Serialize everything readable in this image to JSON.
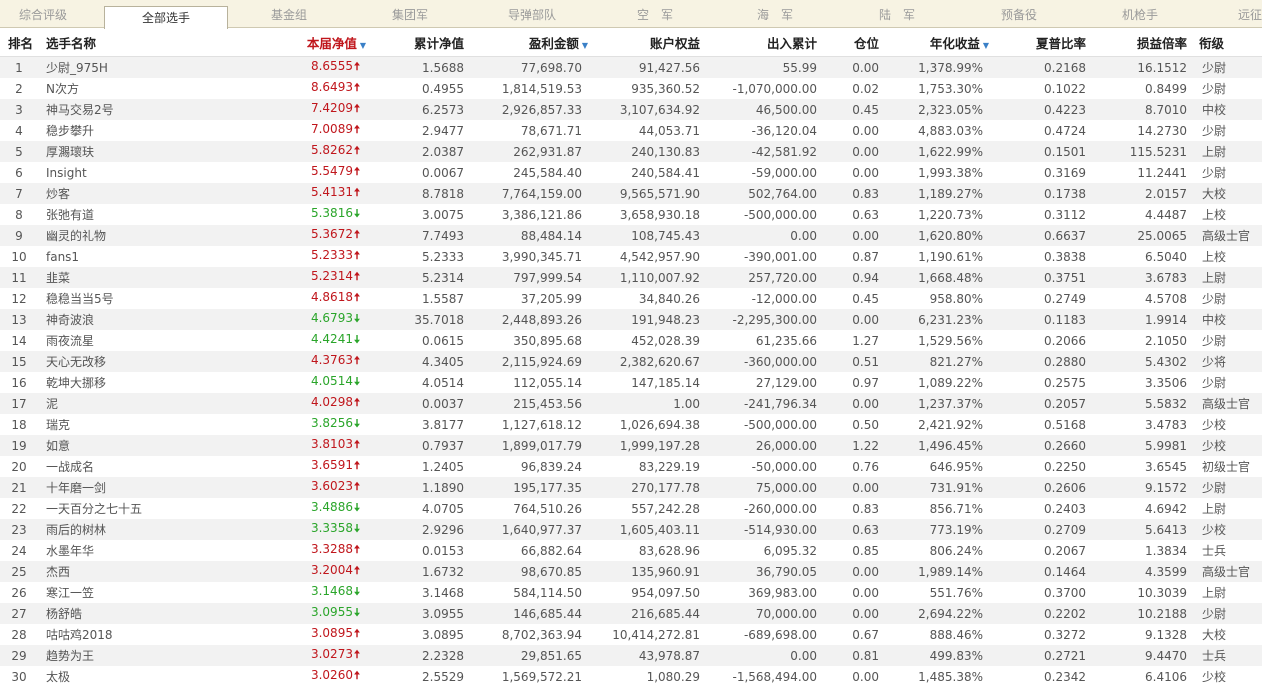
{
  "tabs": [
    {
      "label": "综合评级",
      "active": false
    },
    {
      "label": "全部选手",
      "active": true
    },
    {
      "label": "基金组",
      "active": false
    },
    {
      "label": "集团军",
      "active": false
    },
    {
      "label": "导弹部队",
      "active": false
    },
    {
      "label": "空　军",
      "active": false
    },
    {
      "label": "海　军",
      "active": false
    },
    {
      "label": "陆　军",
      "active": false
    },
    {
      "label": "预备役",
      "active": false
    },
    {
      "label": "机枪手",
      "active": false
    },
    {
      "label": "远征",
      "active": false
    }
  ],
  "columns": {
    "rank": "排名",
    "name": "选手名称",
    "nav": "本届净值",
    "cum": "累计净值",
    "profit": "盈利金额",
    "equity": "账户权益",
    "flow": "出入累计",
    "pos": "仓位",
    "annual": "年化收益",
    "sharpe": "夏普比率",
    "pl": "损益倍率",
    "level": "衔级"
  },
  "sort_indicator": "▼",
  "colors": {
    "up": "#c0161c",
    "down": "#2aa52a",
    "sort": "#3a80c7"
  },
  "rows": [
    {
      "rank": "1",
      "name": "少尉_975H",
      "nav": "8.6555",
      "dir": "up",
      "cum": "1.5688",
      "profit": "77,698.70",
      "equity": "91,427.56",
      "flow": "55.99",
      "pos": "0.00",
      "annual": "1,378.99%",
      "sharpe": "0.2168",
      "pl": "16.1512",
      "level": "少尉"
    },
    {
      "rank": "2",
      "name": "N次方",
      "nav": "8.6493",
      "dir": "up",
      "cum": "0.4955",
      "profit": "1,814,519.53",
      "equity": "935,360.52",
      "flow": "-1,070,000.00",
      "pos": "0.02",
      "annual": "1,753.30%",
      "sharpe": "0.1022",
      "pl": "0.8499",
      "level": "少尉"
    },
    {
      "rank": "3",
      "name": "神马交易2号",
      "nav": "7.4209",
      "dir": "up",
      "cum": "6.2573",
      "profit": "2,926,857.33",
      "equity": "3,107,634.92",
      "flow": "46,500.00",
      "pos": "0.45",
      "annual": "2,323.05%",
      "sharpe": "0.4223",
      "pl": "8.7010",
      "level": "中校"
    },
    {
      "rank": "4",
      "name": "稳步攀升",
      "nav": "7.0089",
      "dir": "up",
      "cum": "2.9477",
      "profit": "78,671.71",
      "equity": "44,053.71",
      "flow": "-36,120.04",
      "pos": "0.00",
      "annual": "4,883.03%",
      "sharpe": "0.4724",
      "pl": "14.2730",
      "level": "少尉"
    },
    {
      "rank": "5",
      "name": "厚瀃瓌玞",
      "nav": "5.8262",
      "dir": "up",
      "cum": "2.0387",
      "profit": "262,931.87",
      "equity": "240,130.83",
      "flow": "-42,581.92",
      "pos": "0.00",
      "annual": "1,622.99%",
      "sharpe": "0.1501",
      "pl": "115.5231",
      "level": "上尉"
    },
    {
      "rank": "6",
      "name": "Insight",
      "nav": "5.5479",
      "dir": "up",
      "cum": "0.0067",
      "profit": "245,584.40",
      "equity": "240,584.41",
      "flow": "-59,000.00",
      "pos": "0.00",
      "annual": "1,993.38%",
      "sharpe": "0.3169",
      "pl": "11.2441",
      "level": "少尉"
    },
    {
      "rank": "7",
      "name": "炒客",
      "nav": "5.4131",
      "dir": "up",
      "cum": "8.7818",
      "profit": "7,764,159.00",
      "equity": "9,565,571.90",
      "flow": "502,764.00",
      "pos": "0.83",
      "annual": "1,189.27%",
      "sharpe": "0.1738",
      "pl": "2.0157",
      "level": "大校"
    },
    {
      "rank": "8",
      "name": "张弛有道",
      "nav": "5.3816",
      "dir": "down",
      "cum": "3.0075",
      "profit": "3,386,121.86",
      "equity": "3,658,930.18",
      "flow": "-500,000.00",
      "pos": "0.63",
      "annual": "1,220.73%",
      "sharpe": "0.3112",
      "pl": "4.4487",
      "level": "上校"
    },
    {
      "rank": "9",
      "name": "幽灵的礼物",
      "nav": "5.3672",
      "dir": "up",
      "cum": "7.7493",
      "profit": "88,484.14",
      "equity": "108,745.43",
      "flow": "0.00",
      "pos": "0.00",
      "annual": "1,620.80%",
      "sharpe": "0.6637",
      "pl": "25.0065",
      "level": "高级士官"
    },
    {
      "rank": "10",
      "name": "fans1",
      "nav": "5.2333",
      "dir": "up",
      "cum": "5.2333",
      "profit": "3,990,345.71",
      "equity": "4,542,957.90",
      "flow": "-390,001.00",
      "pos": "0.87",
      "annual": "1,190.61%",
      "sharpe": "0.3838",
      "pl": "6.5040",
      "level": "上校"
    },
    {
      "rank": "11",
      "name": "韭菜",
      "nav": "5.2314",
      "dir": "up",
      "cum": "5.2314",
      "profit": "797,999.54",
      "equity": "1,110,007.92",
      "flow": "257,720.00",
      "pos": "0.94",
      "annual": "1,668.48%",
      "sharpe": "0.3751",
      "pl": "3.6783",
      "level": "上尉"
    },
    {
      "rank": "12",
      "name": "稳稳当当5号",
      "nav": "4.8618",
      "dir": "up",
      "cum": "1.5587",
      "profit": "37,205.99",
      "equity": "34,840.26",
      "flow": "-12,000.00",
      "pos": "0.45",
      "annual": "958.80%",
      "sharpe": "0.2749",
      "pl": "4.5708",
      "level": "少尉"
    },
    {
      "rank": "13",
      "name": "神奇波浪",
      "nav": "4.6793",
      "dir": "down",
      "cum": "35.7018",
      "profit": "2,448,893.26",
      "equity": "191,948.23",
      "flow": "-2,295,300.00",
      "pos": "0.00",
      "annual": "6,231.23%",
      "sharpe": "0.1183",
      "pl": "1.9914",
      "level": "中校"
    },
    {
      "rank": "14",
      "name": "雨夜流星",
      "nav": "4.4241",
      "dir": "down",
      "cum": "0.0615",
      "profit": "350,895.68",
      "equity": "452,028.39",
      "flow": "61,235.66",
      "pos": "1.27",
      "annual": "1,529.56%",
      "sharpe": "0.2066",
      "pl": "2.1050",
      "level": "少尉"
    },
    {
      "rank": "15",
      "name": "天心无改移",
      "nav": "4.3763",
      "dir": "up",
      "cum": "4.3405",
      "profit": "2,115,924.69",
      "equity": "2,382,620.67",
      "flow": "-360,000.00",
      "pos": "0.51",
      "annual": "821.27%",
      "sharpe": "0.2880",
      "pl": "5.4302",
      "level": "少将"
    },
    {
      "rank": "16",
      "name": "乾坤大挪移",
      "nav": "4.0514",
      "dir": "down",
      "cum": "4.0514",
      "profit": "112,055.14",
      "equity": "147,185.14",
      "flow": "27,129.00",
      "pos": "0.97",
      "annual": "1,089.22%",
      "sharpe": "0.2575",
      "pl": "3.3506",
      "level": "少尉"
    },
    {
      "rank": "17",
      "name": "泥",
      "nav": "4.0298",
      "dir": "up",
      "cum": "0.0037",
      "profit": "215,453.56",
      "equity": "1.00",
      "flow": "-241,796.34",
      "pos": "0.00",
      "annual": "1,237.37%",
      "sharpe": "0.2057",
      "pl": "5.5832",
      "level": "高级士官"
    },
    {
      "rank": "18",
      "name": "瑞克",
      "nav": "3.8256",
      "dir": "down",
      "cum": "3.8177",
      "profit": "1,127,618.12",
      "equity": "1,026,694.38",
      "flow": "-500,000.00",
      "pos": "0.50",
      "annual": "2,421.92%",
      "sharpe": "0.5168",
      "pl": "3.4783",
      "level": "少校"
    },
    {
      "rank": "19",
      "name": "如意",
      "nav": "3.8103",
      "dir": "up",
      "cum": "0.7937",
      "profit": "1,899,017.79",
      "equity": "1,999,197.28",
      "flow": "26,000.00",
      "pos": "1.22",
      "annual": "1,496.45%",
      "sharpe": "0.2660",
      "pl": "5.9981",
      "level": "少校"
    },
    {
      "rank": "20",
      "name": "一战成名",
      "nav": "3.6591",
      "dir": "up",
      "cum": "1.2405",
      "profit": "96,839.24",
      "equity": "83,229.19",
      "flow": "-50,000.00",
      "pos": "0.76",
      "annual": "646.95%",
      "sharpe": "0.2250",
      "pl": "3.6545",
      "level": "初级士官"
    },
    {
      "rank": "21",
      "name": "十年磨一剑",
      "nav": "3.6023",
      "dir": "up",
      "cum": "1.1890",
      "profit": "195,177.35",
      "equity": "270,177.78",
      "flow": "75,000.00",
      "pos": "0.00",
      "annual": "731.91%",
      "sharpe": "0.2606",
      "pl": "9.1572",
      "level": "少尉"
    },
    {
      "rank": "22",
      "name": "一天百分之七十五",
      "nav": "3.4886",
      "dir": "down",
      "cum": "4.0705",
      "profit": "764,510.26",
      "equity": "557,242.28",
      "flow": "-260,000.00",
      "pos": "0.83",
      "annual": "856.71%",
      "sharpe": "0.2403",
      "pl": "4.6942",
      "level": "上尉"
    },
    {
      "rank": "23",
      "name": "雨后的树林",
      "nav": "3.3358",
      "dir": "down",
      "cum": "2.9296",
      "profit": "1,640,977.37",
      "equity": "1,605,403.11",
      "flow": "-514,930.00",
      "pos": "0.63",
      "annual": "773.19%",
      "sharpe": "0.2709",
      "pl": "5.6413",
      "level": "少校"
    },
    {
      "rank": "24",
      "name": "水墨年华",
      "nav": "3.3288",
      "dir": "up",
      "cum": "0.0153",
      "profit": "66,882.64",
      "equity": "83,628.96",
      "flow": "6,095.32",
      "pos": "0.85",
      "annual": "806.24%",
      "sharpe": "0.2067",
      "pl": "1.3834",
      "level": "士兵"
    },
    {
      "rank": "25",
      "name": "杰西",
      "nav": "3.2004",
      "dir": "up",
      "cum": "1.6732",
      "profit": "98,670.85",
      "equity": "135,960.91",
      "flow": "36,790.05",
      "pos": "0.00",
      "annual": "1,989.14%",
      "sharpe": "0.1464",
      "pl": "4.3599",
      "level": "高级士官"
    },
    {
      "rank": "26",
      "name": "寒江一笠",
      "nav": "3.1468",
      "dir": "down",
      "cum": "3.1468",
      "profit": "584,114.50",
      "equity": "954,097.50",
      "flow": "369,983.00",
      "pos": "0.00",
      "annual": "551.76%",
      "sharpe": "0.3700",
      "pl": "10.3039",
      "level": "上尉"
    },
    {
      "rank": "27",
      "name": "杨舒皓",
      "nav": "3.0955",
      "dir": "down",
      "cum": "3.0955",
      "profit": "146,685.44",
      "equity": "216,685.44",
      "flow": "70,000.00",
      "pos": "0.00",
      "annual": "2,694.22%",
      "sharpe": "0.2202",
      "pl": "10.2188",
      "level": "少尉"
    },
    {
      "rank": "28",
      "name": "咕咕鸡2018",
      "nav": "3.0895",
      "dir": "up",
      "cum": "3.0895",
      "profit": "8,702,363.94",
      "equity": "10,414,272.81",
      "flow": "-689,698.00",
      "pos": "0.67",
      "annual": "888.46%",
      "sharpe": "0.3272",
      "pl": "9.1328",
      "level": "大校"
    },
    {
      "rank": "29",
      "name": "趋势为王",
      "nav": "3.0273",
      "dir": "up",
      "cum": "2.2328",
      "profit": "29,851.65",
      "equity": "43,978.87",
      "flow": "0.00",
      "pos": "0.81",
      "annual": "499.83%",
      "sharpe": "0.2721",
      "pl": "9.4470",
      "level": "士兵"
    },
    {
      "rank": "30",
      "name": "太极",
      "nav": "3.0260",
      "dir": "up",
      "cum": "2.5529",
      "profit": "1,569,572.21",
      "equity": "1,080.29",
      "flow": "-1,568,494.00",
      "pos": "0.00",
      "annual": "1,485.38%",
      "sharpe": "0.2342",
      "pl": "6.4106",
      "level": "少校"
    }
  ]
}
